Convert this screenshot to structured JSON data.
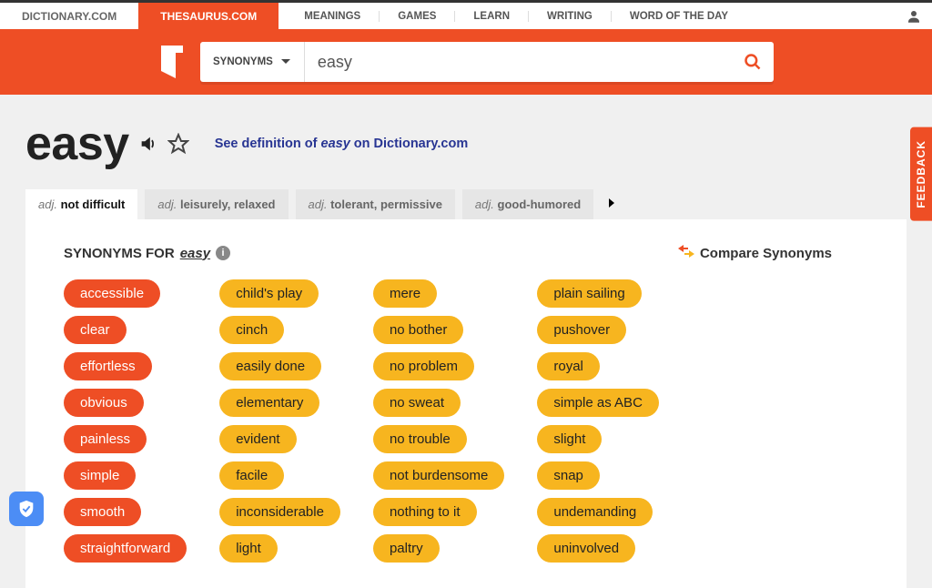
{
  "topnav": {
    "sites": [
      {
        "label": "DICTIONARY.COM",
        "active": false
      },
      {
        "label": "THESAURUS.COM",
        "active": true
      }
    ],
    "items": [
      "MEANINGS",
      "GAMES",
      "LEARN",
      "WRITING",
      "WORD OF THE DAY"
    ]
  },
  "search": {
    "filter_label": "SYNONYMS",
    "value": "easy"
  },
  "headword": "easy",
  "definition_link": {
    "prefix": "See definition of ",
    "word": "easy",
    "suffix": " on Dictionary.com"
  },
  "senses": [
    {
      "pos": "adj.",
      "label": "not difficult",
      "active": true
    },
    {
      "pos": "adj.",
      "label": "leisurely, relaxed",
      "active": false
    },
    {
      "pos": "adj.",
      "label": "tolerant, permissive",
      "active": false
    },
    {
      "pos": "adj.",
      "label": "good-humored",
      "active": false
    }
  ],
  "content": {
    "synonyms_for_prefix": "SYNONYMS FOR",
    "synonyms_for_word": "easy",
    "compare_label": "Compare Synonyms",
    "columns": [
      [
        {
          "word": "accessible",
          "rel": 1
        },
        {
          "word": "clear",
          "rel": 1
        },
        {
          "word": "effortless",
          "rel": 1
        },
        {
          "word": "obvious",
          "rel": 1
        },
        {
          "word": "painless",
          "rel": 1
        },
        {
          "word": "simple",
          "rel": 1
        },
        {
          "word": "smooth",
          "rel": 1
        },
        {
          "word": "straightforward",
          "rel": 1
        }
      ],
      [
        {
          "word": "child's play",
          "rel": 2
        },
        {
          "word": "cinch",
          "rel": 2
        },
        {
          "word": "easily done",
          "rel": 2
        },
        {
          "word": "elementary",
          "rel": 2
        },
        {
          "word": "evident",
          "rel": 2
        },
        {
          "word": "facile",
          "rel": 2
        },
        {
          "word": "inconsiderable",
          "rel": 2
        },
        {
          "word": "light",
          "rel": 2
        }
      ],
      [
        {
          "word": "mere",
          "rel": 2
        },
        {
          "word": "no bother",
          "rel": 2
        },
        {
          "word": "no problem",
          "rel": 2
        },
        {
          "word": "no sweat",
          "rel": 2
        },
        {
          "word": "no trouble",
          "rel": 2
        },
        {
          "word": "not burdensome",
          "rel": 2
        },
        {
          "word": "nothing to it",
          "rel": 2
        },
        {
          "word": "paltry",
          "rel": 2
        }
      ],
      [
        {
          "word": "plain sailing",
          "rel": 2
        },
        {
          "word": "pushover",
          "rel": 2
        },
        {
          "word": "royal",
          "rel": 2
        },
        {
          "word": "simple as ABC",
          "rel": 2
        },
        {
          "word": "slight",
          "rel": 2
        },
        {
          "word": "snap",
          "rel": 2
        },
        {
          "word": "undemanding",
          "rel": 2
        },
        {
          "word": "uninvolved",
          "rel": 2
        }
      ]
    ]
  },
  "feedback_label": "FEEDBACK"
}
